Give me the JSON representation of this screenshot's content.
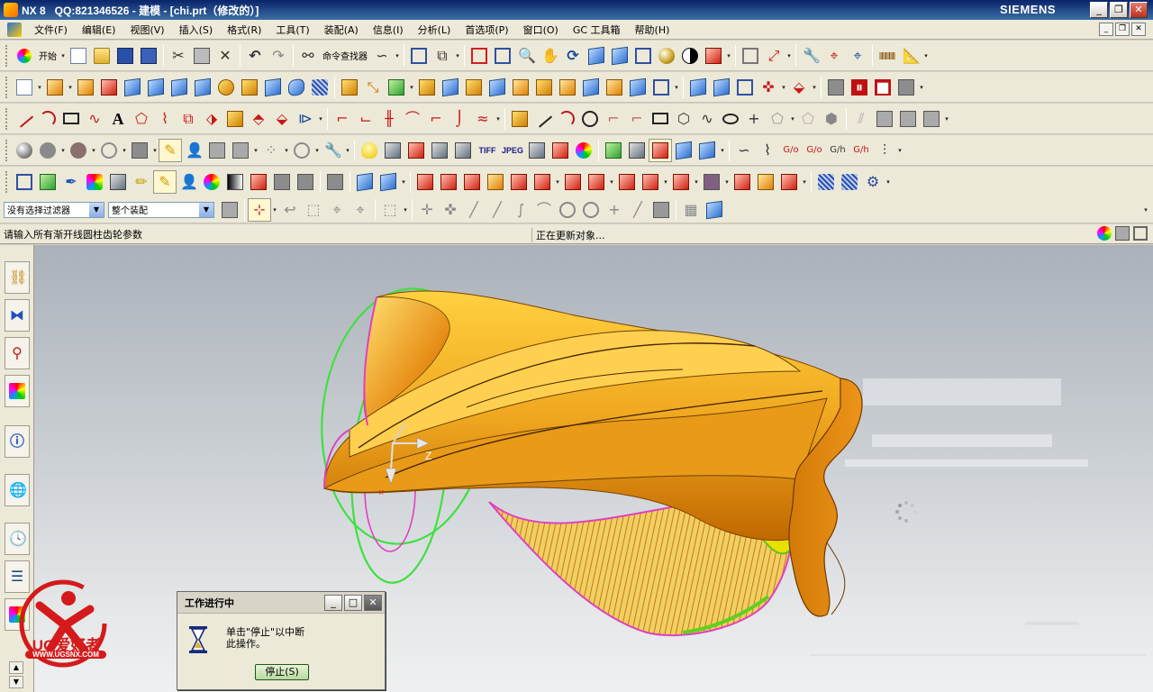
{
  "window": {
    "title": "NX 8   QQ:821346526 - 建模 - [chi.prt（修改的）]",
    "brand": "SIEMENS"
  },
  "menu": {
    "items": [
      "文件(F)",
      "编辑(E)",
      "视图(V)",
      "插入(S)",
      "格式(R)",
      "工具(T)",
      "装配(A)",
      "信息(I)",
      "分析(L)",
      "首选项(P)",
      "窗口(O)",
      "GC 工具箱",
      "帮助(H)"
    ]
  },
  "toolbar": {
    "start_label": "开始",
    "command_finder_label": "命令查找器",
    "tiff_label": "TIFF",
    "jpeg_label": "JPEG"
  },
  "selection": {
    "filter_value": "没有选择过滤器",
    "scope_value": "整个装配"
  },
  "cue": {
    "prompt": "请输入所有渐开线圆柱齿轮参数",
    "status": "正在更新对象..."
  },
  "triad": {
    "z_label": "Z"
  },
  "dialog": {
    "title": "工作进行中",
    "message": "单击\"停止\"以中断\n此操作。",
    "stop_label": "停止(S)"
  },
  "watermark": {
    "brand": "UG爱好者",
    "url": "WWW.UGSNX.COM"
  },
  "colors": {
    "model_face": "#f0a820",
    "model_edge": "#e040c0",
    "helix_curve": "#40e040",
    "accent_red": "#d41a1a"
  }
}
